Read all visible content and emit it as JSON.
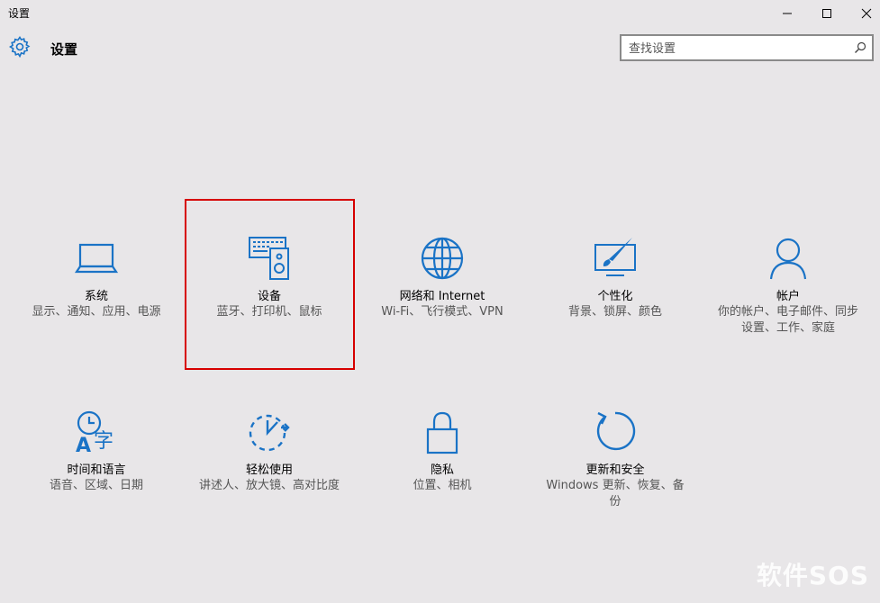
{
  "window": {
    "title": "设置",
    "controls": [
      "minimize-icon",
      "maximize-icon",
      "close-icon"
    ]
  },
  "header": {
    "title": "设置",
    "icon": "gear-icon"
  },
  "search": {
    "placeholder": "查找设置",
    "icon": "search-icon"
  },
  "tiles": [
    {
      "name": "系统",
      "desc": "显示、通知、应用、电源",
      "icon": "laptop-icon"
    },
    {
      "name": "设备",
      "desc": "蓝牙、打印机、鼠标",
      "icon": "devices-icon"
    },
    {
      "name": "网络和 Internet",
      "desc": "Wi-Fi、飞行模式、VPN",
      "icon": "globe-icon"
    },
    {
      "name": "个性化",
      "desc": "背景、锁屏、颜色",
      "icon": "personalization-icon"
    },
    {
      "name": "帐户",
      "desc": "你的帐户、电子邮件、同步设置、工作、家庭",
      "icon": "person-icon"
    },
    {
      "name": "时间和语言",
      "desc": "语音、区域、日期",
      "icon": "time-language-icon"
    },
    {
      "name": "轻松使用",
      "desc": "讲述人、放大镜、高对比度",
      "icon": "ease-of-access-icon"
    },
    {
      "name": "隐私",
      "desc": "位置、相机",
      "icon": "lock-icon"
    },
    {
      "name": "更新和安全",
      "desc": "Windows 更新、恢复、备份",
      "icon": "update-icon"
    }
  ],
  "watermark": "软件SOS",
  "colors": {
    "accent": "#1a73c6",
    "highlight": "#d60000",
    "background": "#e8e6e8"
  }
}
